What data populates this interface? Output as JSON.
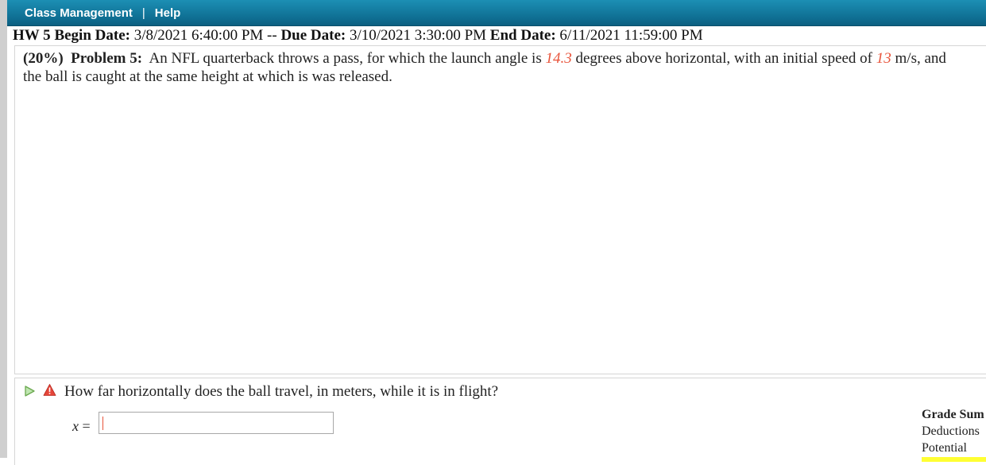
{
  "nav": {
    "class_management": "Class Management",
    "separator": "|",
    "help": "Help"
  },
  "dates": {
    "hw": "HW 5",
    "begin_label": "Begin Date:",
    "begin_value": "3/8/2021 6:40:00 PM",
    "dash": "--",
    "due_label": "Due Date:",
    "due_value": "3/10/2021 3:30:00 PM",
    "end_label": "End Date:",
    "end_value": "6/11/2021 11:59:00 PM"
  },
  "problem": {
    "weight": "(20%)",
    "label": "Problem 5:",
    "text_1": "An NFL quarterback throws a pass, for which the launch angle is",
    "angle": "14.3",
    "text_2": "degrees above horizontal, with an initial speed of",
    "speed": "13",
    "text_3": "m/s, and the ball is caught at the same height at which is was released."
  },
  "question": {
    "text": "How far horizontally does the ball travel, in meters, while it is in flight?",
    "var": "x",
    "eq": "=",
    "input_value": ""
  },
  "grade_summary": {
    "title": "Grade Sum",
    "deductions": "Deductions",
    "potential": "Potential"
  },
  "colors": {
    "accent_blue": "#0f6f93",
    "value_red": "#e8533a",
    "highlight_yellow": "#ffff33"
  },
  "icons": [
    "play-arrow-icon",
    "warning-icon"
  ]
}
